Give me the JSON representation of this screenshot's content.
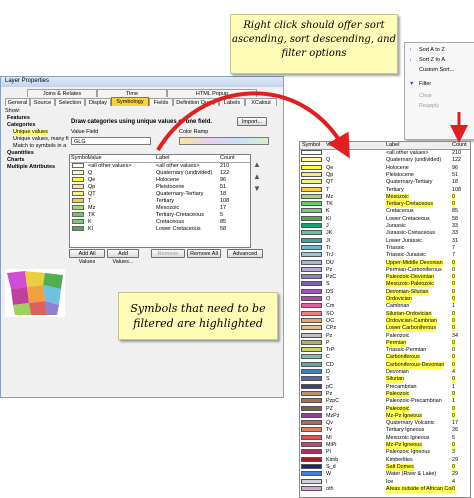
{
  "dialog": {
    "title": "Layer Properties",
    "tabs_row1": [
      "Joins & Relates",
      "Time",
      "HTML Popup"
    ],
    "tabs_row2": [
      "General",
      "Source",
      "Selection",
      "Display",
      "Symbology",
      "Fields",
      "Definition Query",
      "Labels",
      "XCalout"
    ],
    "show_label": "Show:",
    "show_items": [
      "Features",
      "Categories",
      "Unique values",
      "Unique values, many fi",
      "Match to symbols in a",
      "Quantities",
      "Charts",
      "Multiple Attributes"
    ],
    "heading": "Draw categories using unique values of one field.",
    "import_label": "Import...",
    "value_field_label": "Value Field",
    "value_field": "GLG",
    "color_ramp_label": "Color Ramp",
    "table_headers": [
      "Symbol",
      "Value",
      "Label",
      "Count"
    ],
    "rows": [
      {
        "symbol": "#ffffff",
        "value": "<all other values>",
        "label": "<all other values>",
        "count": "210"
      },
      {
        "symbol": "#ffffa0",
        "value": "Q",
        "label": "Quaternary (undivided)",
        "count": "122"
      },
      {
        "symbol": "#ffff33",
        "value": "Qe",
        "label": "Holocene",
        "count": "96"
      },
      {
        "symbol": "#ffe680",
        "value": "Qp",
        "label": "Pleistocene",
        "count": "51"
      },
      {
        "symbol": "#f2f28c",
        "value": "QT",
        "label": "Quaternary-Tertiary",
        "count": "18"
      },
      {
        "symbol": "#ffcc33",
        "value": "T",
        "label": "Tertiary",
        "count": "108"
      },
      {
        "symbol": "#a6d96a",
        "value": "Mz",
        "label": "Mesozoic",
        "count": "17"
      },
      {
        "symbol": "#66cc66",
        "value": "TK",
        "label": "Tertiary-Cretaceous",
        "count": "5"
      },
      {
        "symbol": "#7fc97f",
        "value": "K",
        "label": "Cretaceous",
        "count": "85"
      },
      {
        "symbol": "#4daf4a",
        "value": "Kl",
        "label": "Lower Cretaceous",
        "count": "58"
      }
    ],
    "buttons": [
      "Add All Values",
      "Add Values...",
      "Remove",
      "Remove All",
      "Advanced"
    ]
  },
  "notes": {
    "top": "Right click should offer sort ascending, sort descending, and filter options",
    "middle": "Symbols that need to be filtered are highlighted"
  },
  "context_menu": {
    "items": [
      "Sort A to Z",
      "Sort Z to A",
      "Custom Sort...",
      "Filter",
      "Clear",
      "Reapply"
    ]
  },
  "big_table": {
    "headers": [
      "Symbol",
      "Value",
      "Label",
      "Count"
    ],
    "rows": [
      {
        "c": "#ffffff",
        "v": "",
        "l": "<all other values>",
        "n": "210",
        "h": false
      },
      {
        "c": "#ffffa0",
        "v": "Q",
        "l": "Quaternary (undivided)",
        "n": "122",
        "h": false
      },
      {
        "c": "#ffff33",
        "v": "Qe",
        "l": "Holocene",
        "n": "96",
        "h": false
      },
      {
        "c": "#ffe680",
        "v": "Qp",
        "l": "Pleistocene",
        "n": "51",
        "h": false
      },
      {
        "c": "#f2f28c",
        "v": "QT",
        "l": "Quaternary-Tertiary",
        "n": "18",
        "h": false
      },
      {
        "c": "#ffcc33",
        "v": "T",
        "l": "Tertiary",
        "n": "108",
        "h": false
      },
      {
        "c": "#a6d96a",
        "v": "Mz",
        "l": "Mesozoic",
        "n": "0",
        "h": true
      },
      {
        "c": "#66cc66",
        "v": "TK",
        "l": "Tertiary-Cretaceous",
        "n": "0",
        "h": true
      },
      {
        "c": "#7fc97f",
        "v": "K",
        "l": "Cretaceous",
        "n": "85",
        "h": false
      },
      {
        "c": "#4daf4a",
        "v": "Kl",
        "l": "Lower Cretaceous",
        "n": "58",
        "h": false
      },
      {
        "c": "#1b9e77",
        "v": "J",
        "l": "Jurassic",
        "n": "33",
        "h": false
      },
      {
        "c": "#66c2a5",
        "v": "JK",
        "l": "Jurassic-Cretaceous",
        "n": "33",
        "h": false
      },
      {
        "c": "#3fa0a0",
        "v": "Jl",
        "l": "Lower Jurassic",
        "n": "31",
        "h": false
      },
      {
        "c": "#6bb5d0",
        "v": "Tr",
        "l": "Triassic",
        "n": "7",
        "h": false
      },
      {
        "c": "#8ec6e6",
        "v": "TrJ",
        "l": "Triassic-Jurassic",
        "n": "7",
        "h": false
      },
      {
        "c": "#9db8e0",
        "v": "DU",
        "l": "Upper-Middle Devonian",
        "n": "0",
        "h": true
      },
      {
        "c": "#b3a5d6",
        "v": "Pz",
        "l": "Permian-Carboniferous",
        "n": "0",
        "h": false
      },
      {
        "c": "#8b7ec8",
        "v": "PzC",
        "l": "Paleozoic-Devonian",
        "n": "0",
        "h": true
      },
      {
        "c": "#7b62b8",
        "v": "S",
        "l": "Mesozoic-Paleozoic",
        "n": "0",
        "h": true
      },
      {
        "c": "#a050c0",
        "v": "DS",
        "l": "Devonian-Silurian",
        "n": "0",
        "h": true
      },
      {
        "c": "#c040b0",
        "v": "O",
        "l": "Ordovician",
        "n": "0",
        "h": true
      },
      {
        "c": "#e060a0",
        "v": "Cm",
        "l": "Cambrian",
        "n": "1",
        "h": false
      },
      {
        "c": "#f08080",
        "v": "SO",
        "l": "Silurian-Ordovician",
        "n": "0",
        "h": true
      },
      {
        "c": "#f4a060",
        "v": "OC",
        "l": "Ordovician-Cambrian",
        "n": "0",
        "h": true
      },
      {
        "c": "#e0c090",
        "v": "CPz",
        "l": "Lower Carboniferous",
        "n": "0",
        "h": true
      },
      {
        "c": "#c0c0c0",
        "v": "Pz",
        "l": "Paleozoic",
        "n": "34",
        "h": false
      },
      {
        "c": "#b0b060",
        "v": "P",
        "l": "Permian",
        "n": "0",
        "h": true
      },
      {
        "c": "#d0d060",
        "v": "TrP",
        "l": "Triassic-Permian",
        "n": "0",
        "h": false
      },
      {
        "c": "#80c0a0",
        "v": "C",
        "l": "Carboniferous",
        "n": "0",
        "h": true
      },
      {
        "c": "#60a0c0",
        "v": "CD",
        "l": "Carboniferous-Devonian",
        "n": "0",
        "h": true
      },
      {
        "c": "#4080c0",
        "v": "D",
        "l": "Devonian",
        "n": "4",
        "h": false
      },
      {
        "c": "#6060b0",
        "v": "S",
        "l": "Silurian",
        "n": "0",
        "h": true
      },
      {
        "c": "#404080",
        "v": "pC",
        "l": "Precambrian",
        "n": "1",
        "h": false
      },
      {
        "c": "#c09070",
        "v": "Pz",
        "l": "Paleozoic",
        "n": "0",
        "h": true
      },
      {
        "c": "#a07050",
        "v": "PzpC",
        "l": "Paleozoic-Precambrian",
        "n": "1",
        "h": false
      },
      {
        "c": "#806040",
        "v": "PZ",
        "l": "Paleozoic",
        "n": "0",
        "h": true
      },
      {
        "c": "#904090",
        "v": "MzPz",
        "l": "Mz-Pz Igneous",
        "n": "0",
        "h": true
      },
      {
        "c": "#c06060",
        "v": "Qv",
        "l": "Quaternary Volcanic",
        "n": "17",
        "h": false
      },
      {
        "c": "#e08060",
        "v": "Tv",
        "l": "Tertiary Igneous",
        "n": "26",
        "h": false
      },
      {
        "c": "#e05050",
        "v": "Mi",
        "l": "Mesozoic Igneous",
        "n": "5",
        "h": false
      },
      {
        "c": "#d04080",
        "v": "MiPi",
        "l": "Mz-Pz Igneous",
        "n": "0",
        "h": true
      },
      {
        "c": "#b03060",
        "v": "Pi",
        "l": "Paleozoic Igneous",
        "n": "3",
        "h": false
      },
      {
        "c": "#a02020",
        "v": "Kimb",
        "l": "Kimberlites",
        "n": "29",
        "h": false
      },
      {
        "c": "#202080",
        "v": "S_d",
        "l": "Salt Domes",
        "n": "0",
        "h": true
      },
      {
        "c": "#4080e0",
        "v": "W",
        "l": "Water (River & Lake)",
        "n": "29",
        "h": false
      },
      {
        "c": "#d0d0e0",
        "v": "I",
        "l": "Ice",
        "n": "4",
        "h": false
      },
      {
        "c": "#e0a0e0",
        "v": "oth",
        "l": "Areas outside of African Con",
        "n": "0",
        "h": true
      }
    ]
  }
}
